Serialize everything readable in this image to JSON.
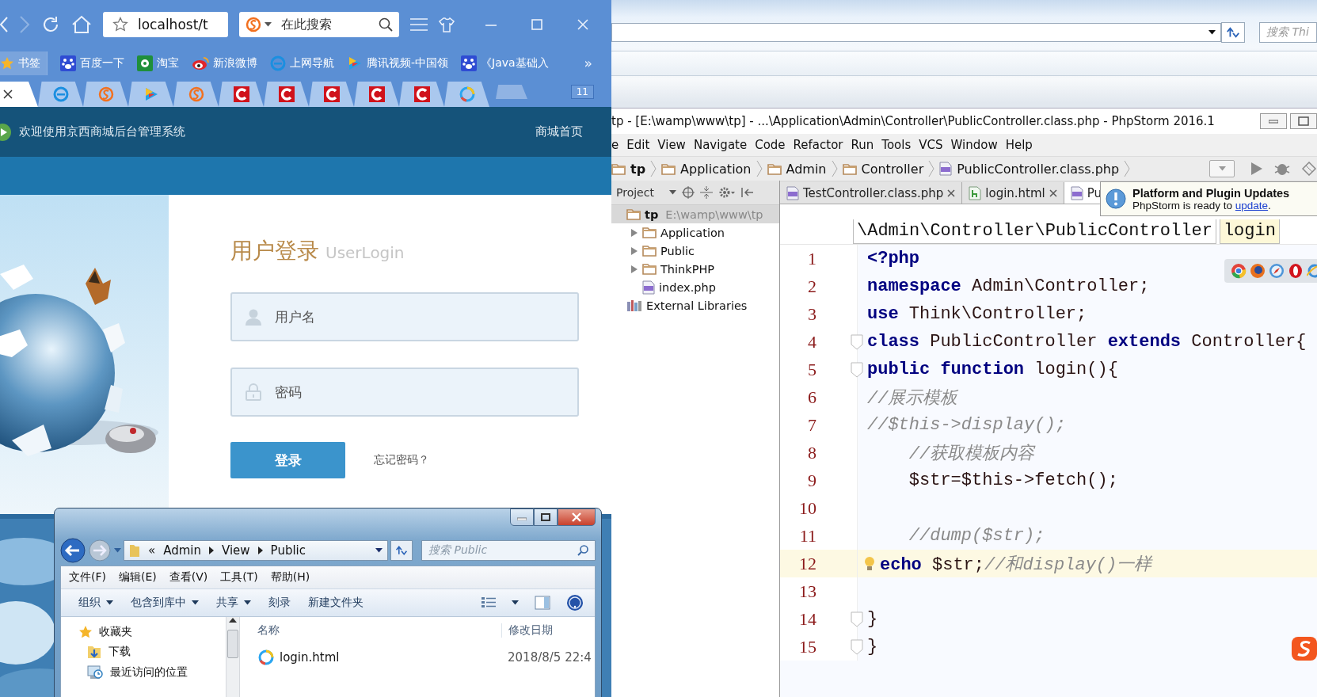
{
  "browser": {
    "url": "localhost/t",
    "search": {
      "placeholder": "在此搜索"
    },
    "bookmarks": [
      {
        "kind": "star",
        "label": "书签"
      },
      {
        "kind": "paw",
        "label": "百度一下"
      },
      {
        "kind": "flower",
        "label": "淘宝"
      },
      {
        "kind": "eye",
        "label": "新浪微博"
      },
      {
        "kind": "ie",
        "label": "上网导航"
      },
      {
        "kind": "video",
        "label": "腾讯视频-中国领"
      },
      {
        "kind": "paw",
        "label": "《Java基础入"
      }
    ],
    "more": "»",
    "tabs": [
      {
        "kind": "blank",
        "selected": true
      },
      {
        "kind": "ie",
        "selected": false
      },
      {
        "kind": "sogou",
        "selected": false
      },
      {
        "kind": "video",
        "selected": false
      },
      {
        "kind": "sogou",
        "selected": false
      },
      {
        "kind": "c",
        "selected": false
      },
      {
        "kind": "c",
        "selected": false
      },
      {
        "kind": "c",
        "selected": false
      },
      {
        "kind": "c",
        "selected": false
      },
      {
        "kind": "c",
        "selected": false
      },
      {
        "kind": "qq",
        "selected": false
      },
      {
        "kind": "new",
        "selected": false
      }
    ],
    "tab_count": "11"
  },
  "page": {
    "welcome": "欢迎使用京西商城后台管理系统",
    "home_link": "商城首页",
    "login": {
      "title": "用户登录",
      "subtitle": "UserLogin",
      "username": {
        "placeholder": "用户名"
      },
      "password": {
        "placeholder": "密码"
      },
      "submit": "登录",
      "forgot": "忘记密码？"
    }
  },
  "explorer": {
    "path": [
      "«",
      "Admin",
      "View",
      "Public"
    ],
    "search": {
      "placeholder": "搜索 Public"
    },
    "menu": [
      "文件(F)",
      "编辑(E)",
      "查看(V)",
      "工具(T)",
      "帮助(H)"
    ],
    "commands": [
      {
        "label": "组织",
        "dropdown": true
      },
      {
        "label": "包含到库中",
        "dropdown": true
      },
      {
        "label": "共享",
        "dropdown": true
      },
      {
        "label": "刻录",
        "dropdown": false
      },
      {
        "label": "新建文件夹",
        "dropdown": false
      }
    ],
    "nav": [
      {
        "kind": "star",
        "label": "收藏夹"
      },
      {
        "kind": "download",
        "label": "下载"
      },
      {
        "kind": "recent",
        "label": "最近访问的位置"
      }
    ],
    "columns": [
      "名称",
      "修改日期"
    ],
    "files": [
      {
        "name": "login.html",
        "modified": "2018/8/5 22:4"
      }
    ]
  },
  "other_window": {
    "search": {
      "placeholder": "搜索 Thi"
    }
  },
  "ide": {
    "title": "tp - [E:\\wamp\\www\\tp] - ...\\Application\\Admin\\Controller\\PublicController.class.php - PhpStorm 2016.1",
    "menu": [
      "e",
      "Edit",
      "View",
      "Navigate",
      "Code",
      "Refactor",
      "Run",
      "Tools",
      "VCS",
      "Window",
      "Help"
    ],
    "breadcrumb": [
      {
        "kind": "folder",
        "label": "tp",
        "bold": true
      },
      {
        "kind": "folder",
        "label": "Application",
        "bold": false
      },
      {
        "kind": "folder",
        "label": "Admin",
        "bold": false
      },
      {
        "kind": "folder",
        "label": "Controller",
        "bold": false
      },
      {
        "kind": "php",
        "label": "PublicController.class.php",
        "bold": false
      }
    ],
    "project": {
      "title": "Project",
      "tree": [
        {
          "kind": "folder",
          "label": "tp",
          "path": "E:\\wamp\\www\\tp",
          "selected": true,
          "children": [
            {
              "kind": "folder",
              "label": "Application",
              "expanded": false,
              "selected": false
            },
            {
              "kind": "folder",
              "label": "Public",
              "expanded": false,
              "selected": false
            },
            {
              "kind": "folder",
              "label": "ThinkPHP",
              "expanded": false,
              "selected": false
            },
            {
              "kind": "php",
              "label": "index.php",
              "selected": false
            }
          ]
        },
        {
          "kind": "library",
          "label": "External Libraries",
          "selected": false
        }
      ]
    },
    "tabs": [
      {
        "kind": "php",
        "label": "TestController.class.php",
        "selected": false
      },
      {
        "kind": "html",
        "label": "login.html",
        "selected": false
      },
      {
        "kind": "php",
        "label": "Pu",
        "selected": true
      }
    ],
    "scope": [
      "\\Admin\\Controller\\PublicController",
      "login"
    ],
    "notification": {
      "title": "Platform and Plugin Updates",
      "message": "PhpStorm is ready to ",
      "link": "update",
      "after": "."
    },
    "lines": [
      {
        "number": "1",
        "tokens": [
          {
            "kind": "keyword",
            "text": "<?php"
          }
        ]
      },
      {
        "number": "2",
        "tokens": [
          {
            "kind": "keyword",
            "text": "namespace"
          },
          {
            "kind": "plain",
            "text": " Admin\\Controller;"
          }
        ]
      },
      {
        "number": "3",
        "tokens": [
          {
            "kind": "keyword",
            "text": "use"
          },
          {
            "kind": "plain",
            "text": " Think\\Controller;"
          }
        ]
      },
      {
        "number": "4",
        "fold": true,
        "tokens": [
          {
            "kind": "keyword",
            "text": "class"
          },
          {
            "kind": "plain",
            "text": " PublicController "
          },
          {
            "kind": "keyword",
            "text": "extends"
          },
          {
            "kind": "plain",
            "text": " Controller{"
          }
        ]
      },
      {
        "number": "5",
        "fold": true,
        "tokens": [
          {
            "kind": "keyword",
            "text": "public function"
          },
          {
            "kind": "plain",
            "text": " login(){"
          }
        ]
      },
      {
        "number": "6",
        "tokens": [
          {
            "kind": "comment",
            "text": "//展示模板"
          }
        ]
      },
      {
        "number": "7",
        "tokens": [
          {
            "kind": "comment",
            "text": "//$this->display();"
          }
        ]
      },
      {
        "number": "8",
        "tokens": [
          {
            "kind": "comment",
            "text": "    //获取模板内容"
          }
        ]
      },
      {
        "number": "9",
        "tokens": [
          {
            "kind": "plain",
            "text": "    $str=$this->fetch();"
          }
        ]
      },
      {
        "number": "10"
      },
      {
        "number": "11",
        "tokens": [
          {
            "kind": "comment",
            "text": "    //dump($str);"
          }
        ]
      },
      {
        "number": "12",
        "current": true,
        "tokens": [
          {
            "kind": "keyword",
            "text": "echo"
          },
          {
            "kind": "plain",
            "text": " $str;"
          },
          {
            "kind": "comment",
            "text": "//和display()一样"
          }
        ]
      },
      {
        "number": "13"
      },
      {
        "number": "14",
        "fold": true,
        "tokens": [
          {
            "kind": "plain",
            "text": "}"
          }
        ]
      },
      {
        "number": "15",
        "fold": true,
        "tokens": [
          {
            "kind": "plain",
            "text": "}"
          }
        ]
      }
    ]
  }
}
